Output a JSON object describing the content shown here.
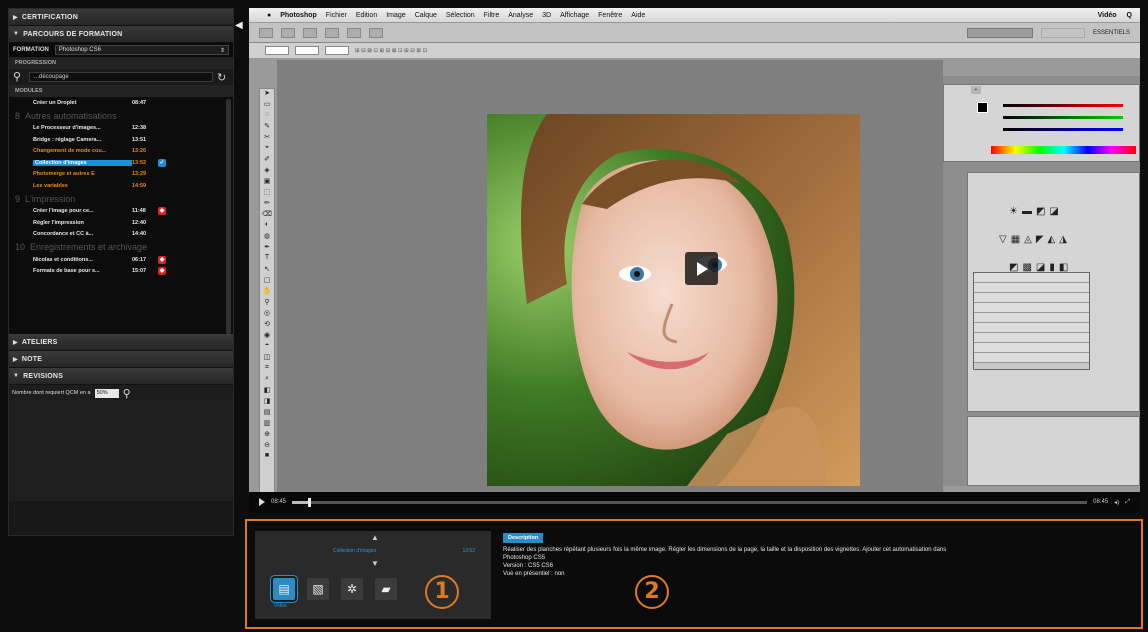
{
  "sidebar": {
    "sections": {
      "certification": "CERTIFICATION",
      "parcours": "PARCOURS DE FORMATION",
      "ateliers": "ATELIERS",
      "note": "NOTE",
      "revisions": "REVISIONS"
    },
    "formation_label": "FORMATION",
    "formation_value": "Photoshop CS6",
    "progression_label": "PROGRESSION",
    "search_value": "...découpage",
    "modules_label": "MODULES",
    "modules": [
      {
        "title": "",
        "items": [
          {
            "t": "Créer un Droplet",
            "d": "08:47",
            "state": "normal"
          }
        ]
      },
      {
        "title": "Autres automatisations",
        "items": [
          {
            "t": "Le Processeur d'images...",
            "d": "12:38",
            "state": "normal"
          },
          {
            "t": "Bridge : réglage Camera...",
            "d": "13:51",
            "state": "normal"
          },
          {
            "t": "Changement de mode cou...",
            "d": "13:26",
            "state": "orange"
          },
          {
            "t": "Collection d'images",
            "d": "13:52",
            "state": "selected"
          },
          {
            "t": "Photomerge et autres E",
            "d": "13:29",
            "state": "orange"
          },
          {
            "t": "Les variables",
            "d": "14:59",
            "state": "orange"
          }
        ]
      },
      {
        "title": "L'impression",
        "items": [
          {
            "t": "Créer l'image pour ce...",
            "d": "11:48",
            "state": "badge"
          },
          {
            "t": "Régler l'impression",
            "d": "12:40",
            "state": "normal"
          },
          {
            "t": "Concordance et CC à...",
            "d": "14:40",
            "state": "normal"
          }
        ]
      },
      {
        "title": "Enregistrements et archivage",
        "items": [
          {
            "t": "Nicolas et conditions...",
            "d": "06:17",
            "state": "badge"
          },
          {
            "t": "Formats de base pour s...",
            "d": "15:07",
            "state": "badge"
          }
        ]
      }
    ],
    "module_numbers": [
      "8",
      "9",
      "10"
    ],
    "revisions_question": "Nombre dont requiert QCM en a",
    "revisions_value": "50%"
  },
  "player": {
    "menubar": [
      "Photoshop",
      "Fichier",
      "Edition",
      "Image",
      "Calque",
      "Sélection",
      "Filtre",
      "Analyse",
      "3D",
      "Affichage",
      "Fenêtre",
      "Aide"
    ],
    "menubar_right": [
      "Vidéo",
      "Q"
    ],
    "essentiels": "ESSENTIELS",
    "time_current": "08:45",
    "time_total": "08:45",
    "progress": 0.02
  },
  "bottom": {
    "nav_label": "Collection d'images",
    "nav_right": "13:52",
    "tools": [
      "film-icon",
      "document-icon",
      "puzzle-icon",
      "folder-icon"
    ],
    "active_caption": "Vidéo",
    "markers": [
      "1",
      "2"
    ],
    "desc_tab": "Description",
    "desc_lines": [
      "Réaliser des planches répétant plusieurs fois la même image. Régler les dimensions de la page, la taille et la disposition des vignettes. Ajouter cet automatisation dans",
      "Photoshop CS5",
      "Version : CS5 CS6",
      "Vue en présentiel : non"
    ]
  }
}
